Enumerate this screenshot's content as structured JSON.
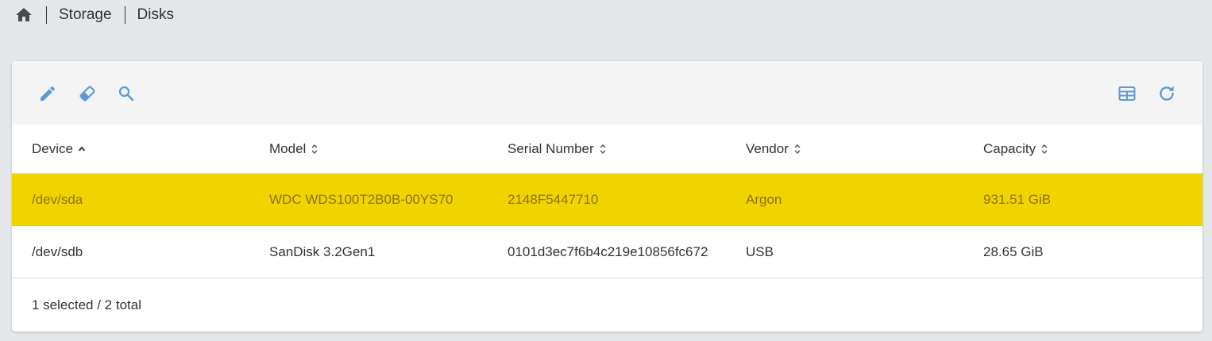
{
  "breadcrumb": {
    "items": [
      "Storage",
      "Disks"
    ]
  },
  "toolbar": {
    "left_icons": [
      "pencil-icon",
      "eraser-icon",
      "search-icon"
    ],
    "right_icons": [
      "table-columns-icon",
      "refresh-icon"
    ],
    "icon_color": "#5b9bd5"
  },
  "table": {
    "columns": [
      "Device",
      "Model",
      "Serial Number",
      "Vendor",
      "Capacity"
    ],
    "sorted_column": "Device",
    "sort_direction": "ascending",
    "rows": [
      {
        "device": "/dev/sda",
        "model": "WDC WDS100T2B0B-00YS70",
        "serial": "2148F5447710",
        "vendor": "Argon",
        "capacity": "931.51 GiB",
        "selected": true
      },
      {
        "device": "/dev/sdb",
        "model": "SanDisk 3.2Gen1",
        "serial": "0101d3ec7f6b4c219e10856fc672",
        "vendor": "USB",
        "capacity": "28.65 GiB",
        "selected": false
      }
    ],
    "selected_row_color": "#f0d400"
  },
  "footer": {
    "status": "1 selected / 2 total"
  }
}
